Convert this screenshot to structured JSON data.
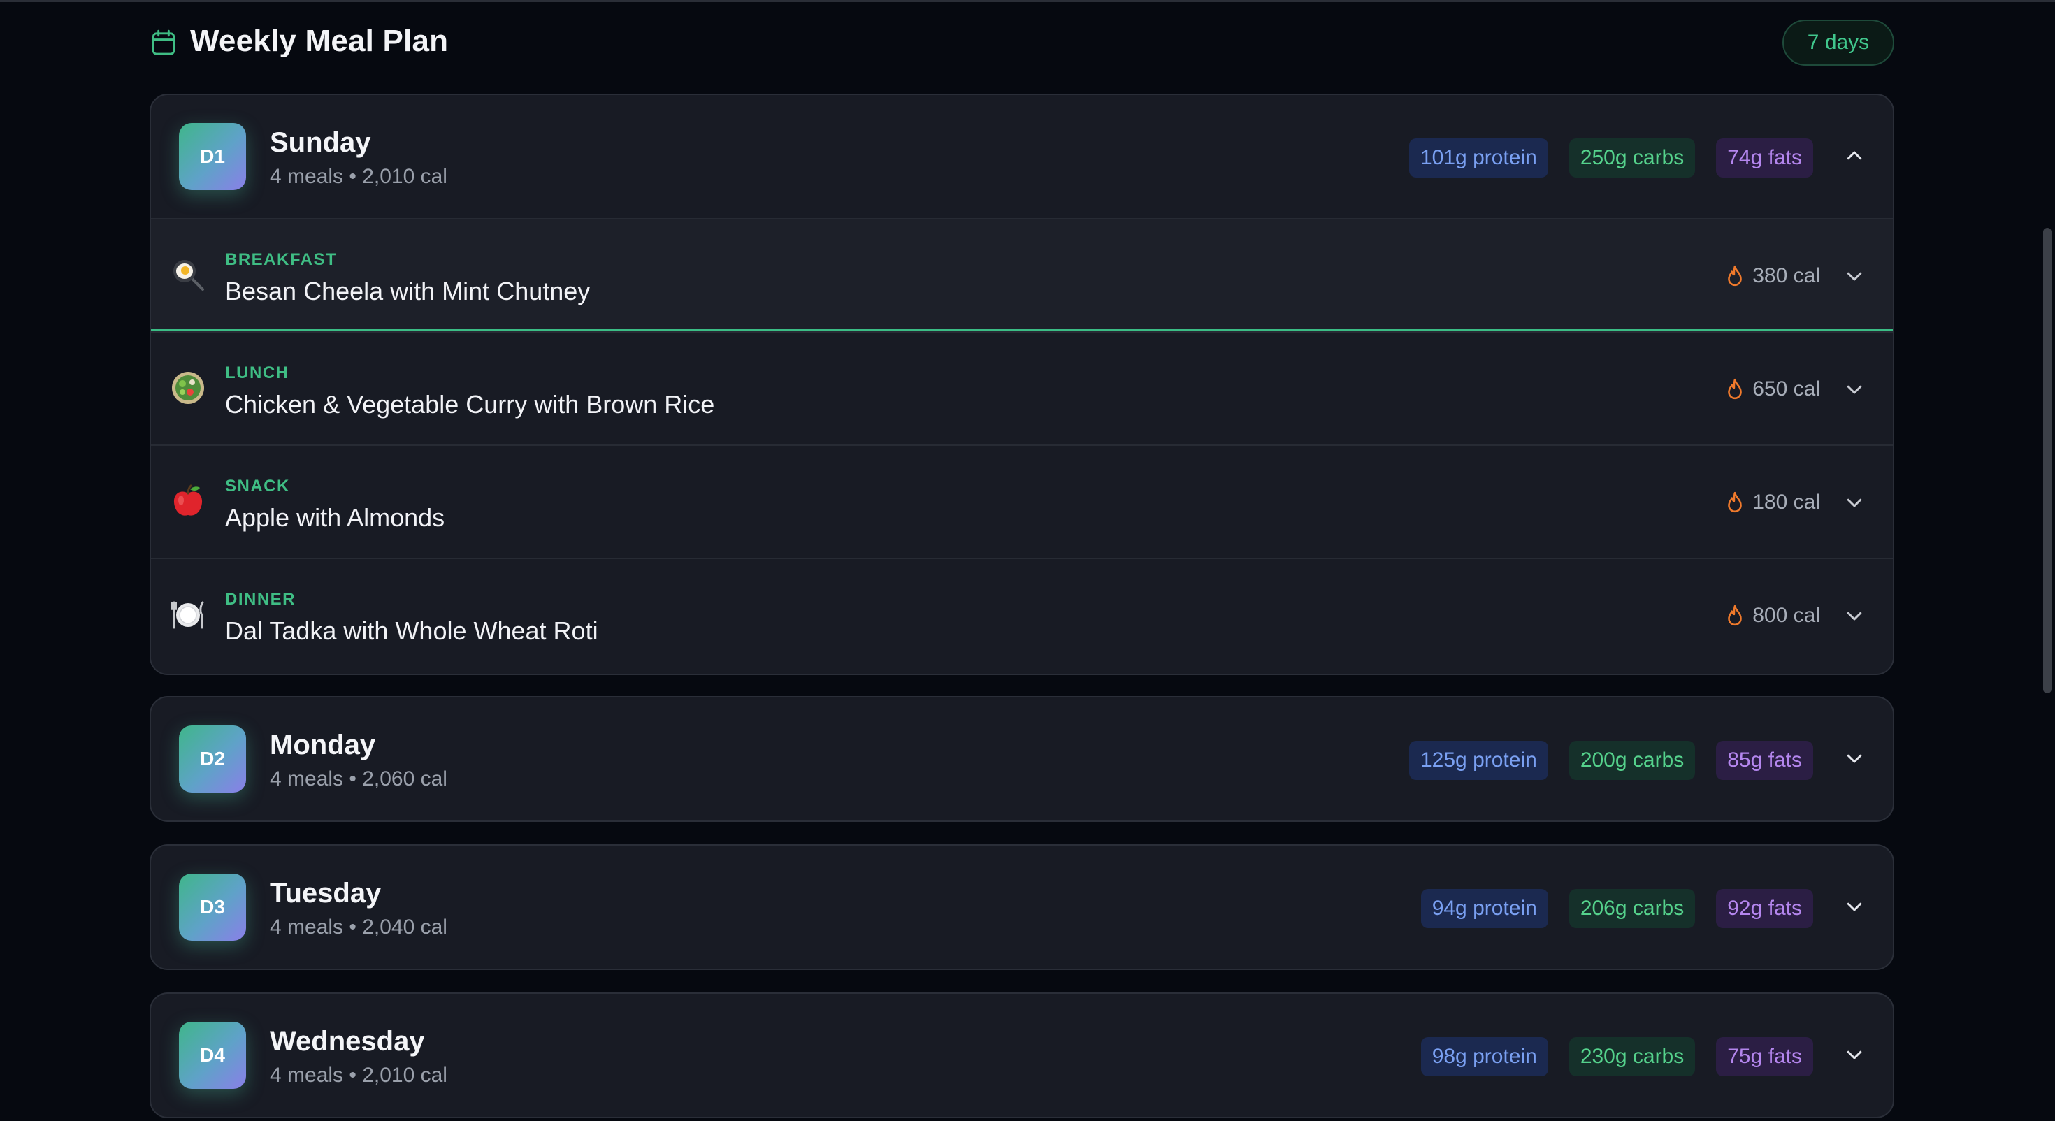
{
  "header": {
    "title": "Weekly Meal Plan",
    "days_count": "7 days",
    "icon": "calendar-icon"
  },
  "colors": {
    "accent_green": "#3fbd84",
    "protein": "#7aa0f2",
    "carbs": "#55d28c",
    "fats": "#b486ee",
    "flame": "#f07a2c"
  },
  "days": [
    {
      "badge": "D1",
      "name": "Sunday",
      "meta": "4 meals • 2,010 cal",
      "protein": "101g protein",
      "carbs": "250g carbs",
      "fats": "74g fats",
      "expanded": true,
      "meals": [
        {
          "type": "BREAKFAST",
          "name": "Besan Cheela with Mint Chutney",
          "cal": "380 cal",
          "icon": "frying-pan-icon"
        },
        {
          "type": "LUNCH",
          "name": "Chicken & Vegetable Curry with Brown Rice",
          "cal": "650 cal",
          "icon": "salad-bowl-icon"
        },
        {
          "type": "SNACK",
          "name": "Apple with Almonds",
          "cal": "180 cal",
          "icon": "apple-icon"
        },
        {
          "type": "DINNER",
          "name": "Dal Tadka with Whole Wheat Roti",
          "cal": "800 cal",
          "icon": "plate-cutlery-icon"
        }
      ]
    },
    {
      "badge": "D2",
      "name": "Monday",
      "meta": "4 meals • 2,060 cal",
      "protein": "125g protein",
      "carbs": "200g carbs",
      "fats": "85g fats",
      "expanded": false
    },
    {
      "badge": "D3",
      "name": "Tuesday",
      "meta": "4 meals • 2,040 cal",
      "protein": "94g protein",
      "carbs": "206g carbs",
      "fats": "92g fats",
      "expanded": false
    },
    {
      "badge": "D4",
      "name": "Wednesday",
      "meta": "4 meals • 2,010 cal",
      "protein": "98g protein",
      "carbs": "230g carbs",
      "fats": "75g fats",
      "expanded": false
    }
  ]
}
